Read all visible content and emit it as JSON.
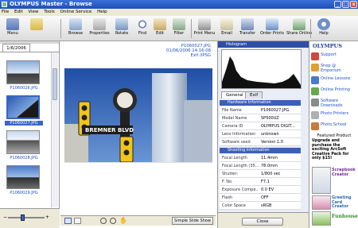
{
  "window": {
    "title": "OLYMPUS Master - Browse",
    "min": "_",
    "max": "□",
    "close": "x"
  },
  "menu": [
    "File",
    "Edit",
    "View",
    "Tools",
    "Online Service",
    "Help"
  ],
  "toolbar": {
    "menu": "Menu",
    "browse": "Browse",
    "properties": "Properties",
    "rotate": "Rotate",
    "find": "Find",
    "edit": "Edit",
    "filter": "Filter",
    "print_menu": "Print Menu",
    "email": "Email",
    "transfer": "Transfer",
    "order_prints": "Order Prints",
    "share_online": "Share Online",
    "help": "Help"
  },
  "left": {
    "date_tab": "1/6/2006",
    "thumbs": [
      "P1060026.JPG",
      "P1060027.JPG",
      "P1060028.JPG",
      "P1060029.JPG"
    ]
  },
  "center": {
    "meta_file": "P1060027.JPG",
    "meta_date": "01/06/2006 14:16:08",
    "meta_link": "Exif /IPSG",
    "sign_text": "BREMNER BLVD",
    "slideshow": "Simple Slide Show"
  },
  "info": {
    "histogram_title": "Histogram",
    "tab_general": "General",
    "tab_exif": "Exif",
    "hw_title": "Hardware Information",
    "hw": [
      {
        "k": "File Name",
        "v": "P1060027.JPG"
      },
      {
        "k": "Model Name",
        "v": "SP500UZ"
      },
      {
        "k": "Camera ID",
        "v": "OLYMPUS DIGIT..."
      },
      {
        "k": "Lens Information",
        "v": "unknown"
      },
      {
        "k": "Software used",
        "v": "Version 1.0"
      }
    ],
    "shoot_title": "Shooting Information",
    "shoot": [
      {
        "k": "Focal Length",
        "v": "11.4mm"
      },
      {
        "k": "Focal Length (35...",
        "v": "78.0mm"
      },
      {
        "k": "Shutter:",
        "v": "1/800 sec"
      },
      {
        "k": "F. No.",
        "v": "F7.1"
      },
      {
        "k": "Exposure Compe...",
        "v": "0.0 EV"
      },
      {
        "k": "Flash",
        "v": "OFF"
      },
      {
        "k": "Color Space",
        "v": "sRGB"
      }
    ],
    "close": "Close"
  },
  "olympus": {
    "logo": "OLYMPUS",
    "items": [
      "Support",
      "Shop @ Emporium",
      "Online Lessons",
      "Online Printing",
      "Software Downloads",
      "Photo Printers",
      "Photo School"
    ],
    "featured_title": "Featured Product",
    "featured_text": "Upgrade and purchase the exciting ArcSoft Creative Pack for only $15!",
    "products": [
      "Scrapbook Creator",
      "Greeting Card Creator",
      "Funhouse"
    ]
  },
  "colors": {
    "titlebar": "#2456c4",
    "link": "#2050c0",
    "panel_header": "#3b5fb8"
  }
}
